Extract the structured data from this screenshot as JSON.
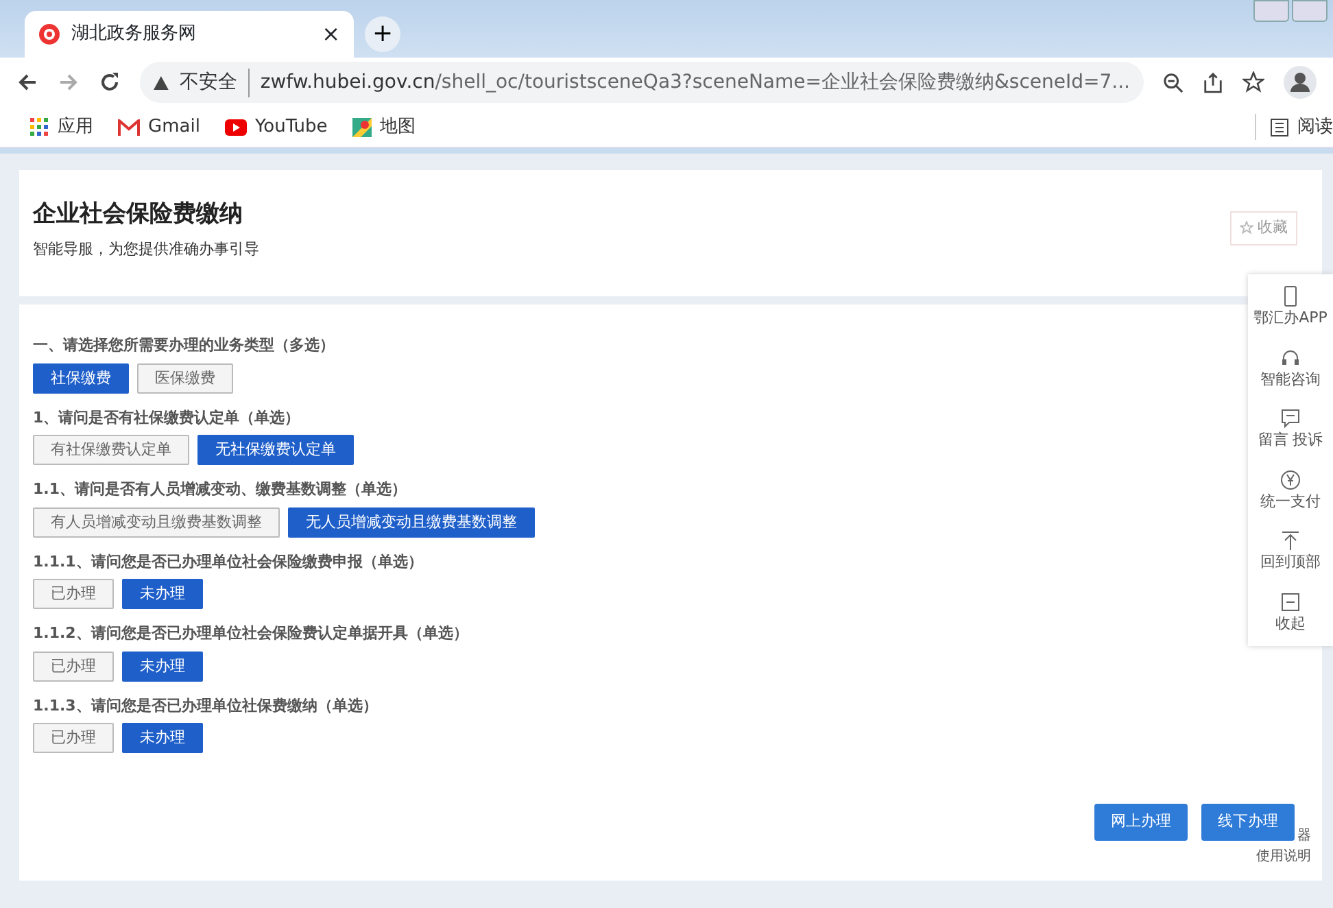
{
  "browser": {
    "tab_title": "湖北政务服务网",
    "tab_close": "×",
    "new_tab": "+",
    "security": "不安全",
    "url_host": "zwfw.hubei.gov.cn",
    "url_rest": "/shell_oc/touristsceneQa3?sceneName=企业社会保险费缴纳&sceneId=7...",
    "bookmarks": [
      {
        "kind": "apps",
        "label": "应用"
      },
      {
        "kind": "gmail",
        "label": "Gmail"
      },
      {
        "kind": "youtube",
        "label": "YouTube"
      },
      {
        "kind": "maps",
        "label": "地图"
      }
    ],
    "reading_list": "阅读"
  },
  "header": {
    "title": "企业社会保险费缴纳",
    "subtitle": "智能导服，为您提供准确办事引导",
    "favorite": "收藏"
  },
  "questions": [
    {
      "title": "一、请选择您所需要办理的业务类型（多选）",
      "options": [
        {
          "label": "社保缴费",
          "selected": true
        },
        {
          "label": "医保缴费",
          "selected": false
        }
      ]
    },
    {
      "title": "1、请问是否有社保缴费认定单（单选）",
      "options": [
        {
          "label": "有社保缴费认定单",
          "selected": false
        },
        {
          "label": "无社保缴费认定单",
          "selected": true
        }
      ]
    },
    {
      "title": "1.1、请问是否有人员增减变动、缴费基数调整（单选）",
      "options": [
        {
          "label": "有人员增减变动且缴费基数调整",
          "selected": false
        },
        {
          "label": "无人员增减变动且缴费基数调整",
          "selected": true
        }
      ]
    },
    {
      "title": "1.1.1、请问您是否已办理单位社会保险缴费申报（单选）",
      "options": [
        {
          "label": "已办理",
          "selected": false
        },
        {
          "label": "未办理",
          "selected": true
        }
      ]
    },
    {
      "title": "1.1.2、请问您是否已办理单位社会保险费认定单据开具（单选）",
      "options": [
        {
          "label": "已办理",
          "selected": false
        },
        {
          "label": "未办理",
          "selected": true
        }
      ]
    },
    {
      "title": "1.1.3、请问您是否已办理单位社保费缴纳（单选）",
      "options": [
        {
          "label": "已办理",
          "selected": false
        },
        {
          "label": "未办理",
          "selected": true
        }
      ]
    }
  ],
  "actions": [
    "网上办理",
    "线下办理"
  ],
  "side_tools": [
    {
      "kind": "phone",
      "label": "鄂汇办APP"
    },
    {
      "kind": "headset",
      "label": "智能咨询"
    },
    {
      "kind": "message",
      "label": "留言 投诉"
    },
    {
      "kind": "yen",
      "label": "统一支付"
    },
    {
      "kind": "top",
      "label": "回到顶部"
    },
    {
      "kind": "collapse",
      "label": "收起"
    }
  ],
  "browser_note": [
    "器",
    "使用说明"
  ]
}
